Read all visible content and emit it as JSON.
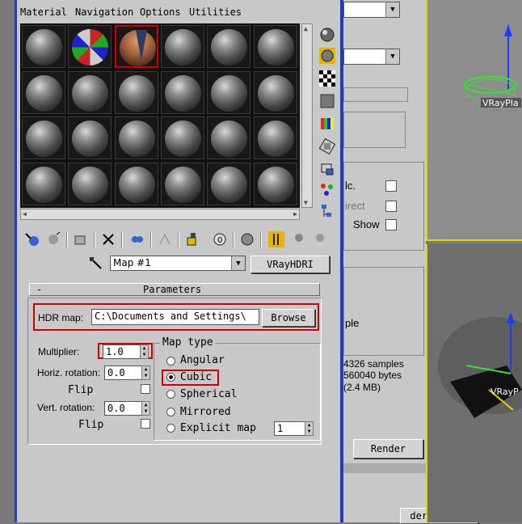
{
  "colors": {
    "window_border": "#1e3cc4",
    "highlight_red": "#d00000",
    "grid_yellow": "#e6d400"
  },
  "menu": [
    "Material",
    "Navigation",
    "Options",
    "Utilities"
  ],
  "map": {
    "name": "Map #1",
    "type_button": "VRayHDRI"
  },
  "params": {
    "rollout_toggle": "-",
    "title": "Parameters",
    "hdr_label": "HDR map:",
    "hdr_path": "C:\\Documents and Settings\\",
    "browse": "Browse",
    "multiplier_label": "Multiplier:",
    "multiplier": "1.0",
    "horiz_label": "Horiz. rotation:",
    "horiz": "0.0",
    "flip1": "Flip",
    "vert_label": "Vert. rotation:",
    "vert": "0.0",
    "flip2": "Flip",
    "maptype_title": "Map type",
    "maptypes": [
      "Angular",
      "Cubic",
      "Spherical",
      "Mirrored",
      "Explicit map"
    ],
    "explicit_value": "1"
  },
  "right": {
    "calc": "lc.",
    "direct": "irect",
    "show": "Show",
    "sample": "ple",
    "samples": "4326 samples",
    "bytes": "560040 bytes",
    "mb": "(2.4 MB)",
    "render": "Render",
    "bottom_tab": "der deider"
  },
  "viewport": {
    "label_top": "VRayPla",
    "label_bottom": "VRayP"
  },
  "icons": [
    "sphere-type-icon",
    "backlight-icon",
    "background-icon",
    "tiling-icon",
    "video-color-icon",
    "make-preview-icon",
    "options-icon",
    "select-by-material-icon",
    "material-map-nav-icon",
    "get-material-icon",
    "put-to-scene-icon",
    "put-to-library-icon",
    "delete-icon",
    "make-unique-icon",
    "show-map-icon",
    "show-end-result-icon",
    "go-parent-icon",
    "go-sibling-icon",
    "pick-icon"
  ]
}
